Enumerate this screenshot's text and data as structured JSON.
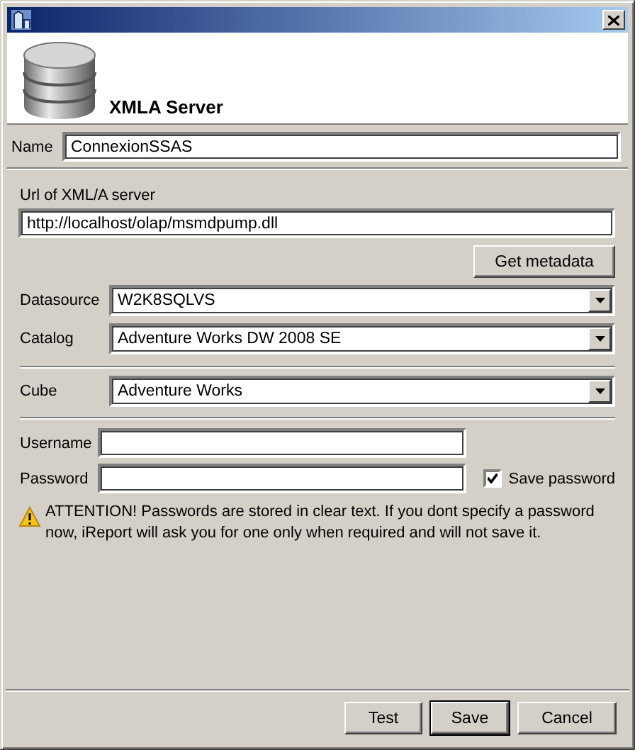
{
  "header": {
    "title": "XMLA Server"
  },
  "name_field": {
    "label": "Name",
    "value": "ConnexionSSAS"
  },
  "url_field": {
    "label": "Url of XML/A server",
    "value": "http://localhost/olap/msmdpump.dll"
  },
  "get_metadata_button": "Get metadata",
  "metadata_selects": [
    {
      "label": "Datasource",
      "value": "W2K8SQLVS"
    },
    {
      "label": "Catalog",
      "value": "Adventure Works DW 2008 SE"
    }
  ],
  "cube_select": {
    "label": "Cube",
    "value": "Adventure Works"
  },
  "username": {
    "label": "Username"
  },
  "password": {
    "label": "Password"
  },
  "save_password": {
    "label": "Save password",
    "checked": true
  },
  "warning": "ATTENTION! Passwords are stored in clear text. If you dont specify a password now, iReport will ask you for one only when required and will not save it.",
  "buttons": [
    {
      "label": "Test",
      "default": false
    },
    {
      "label": "Save",
      "default": true
    },
    {
      "label": "Cancel",
      "default": false
    }
  ]
}
